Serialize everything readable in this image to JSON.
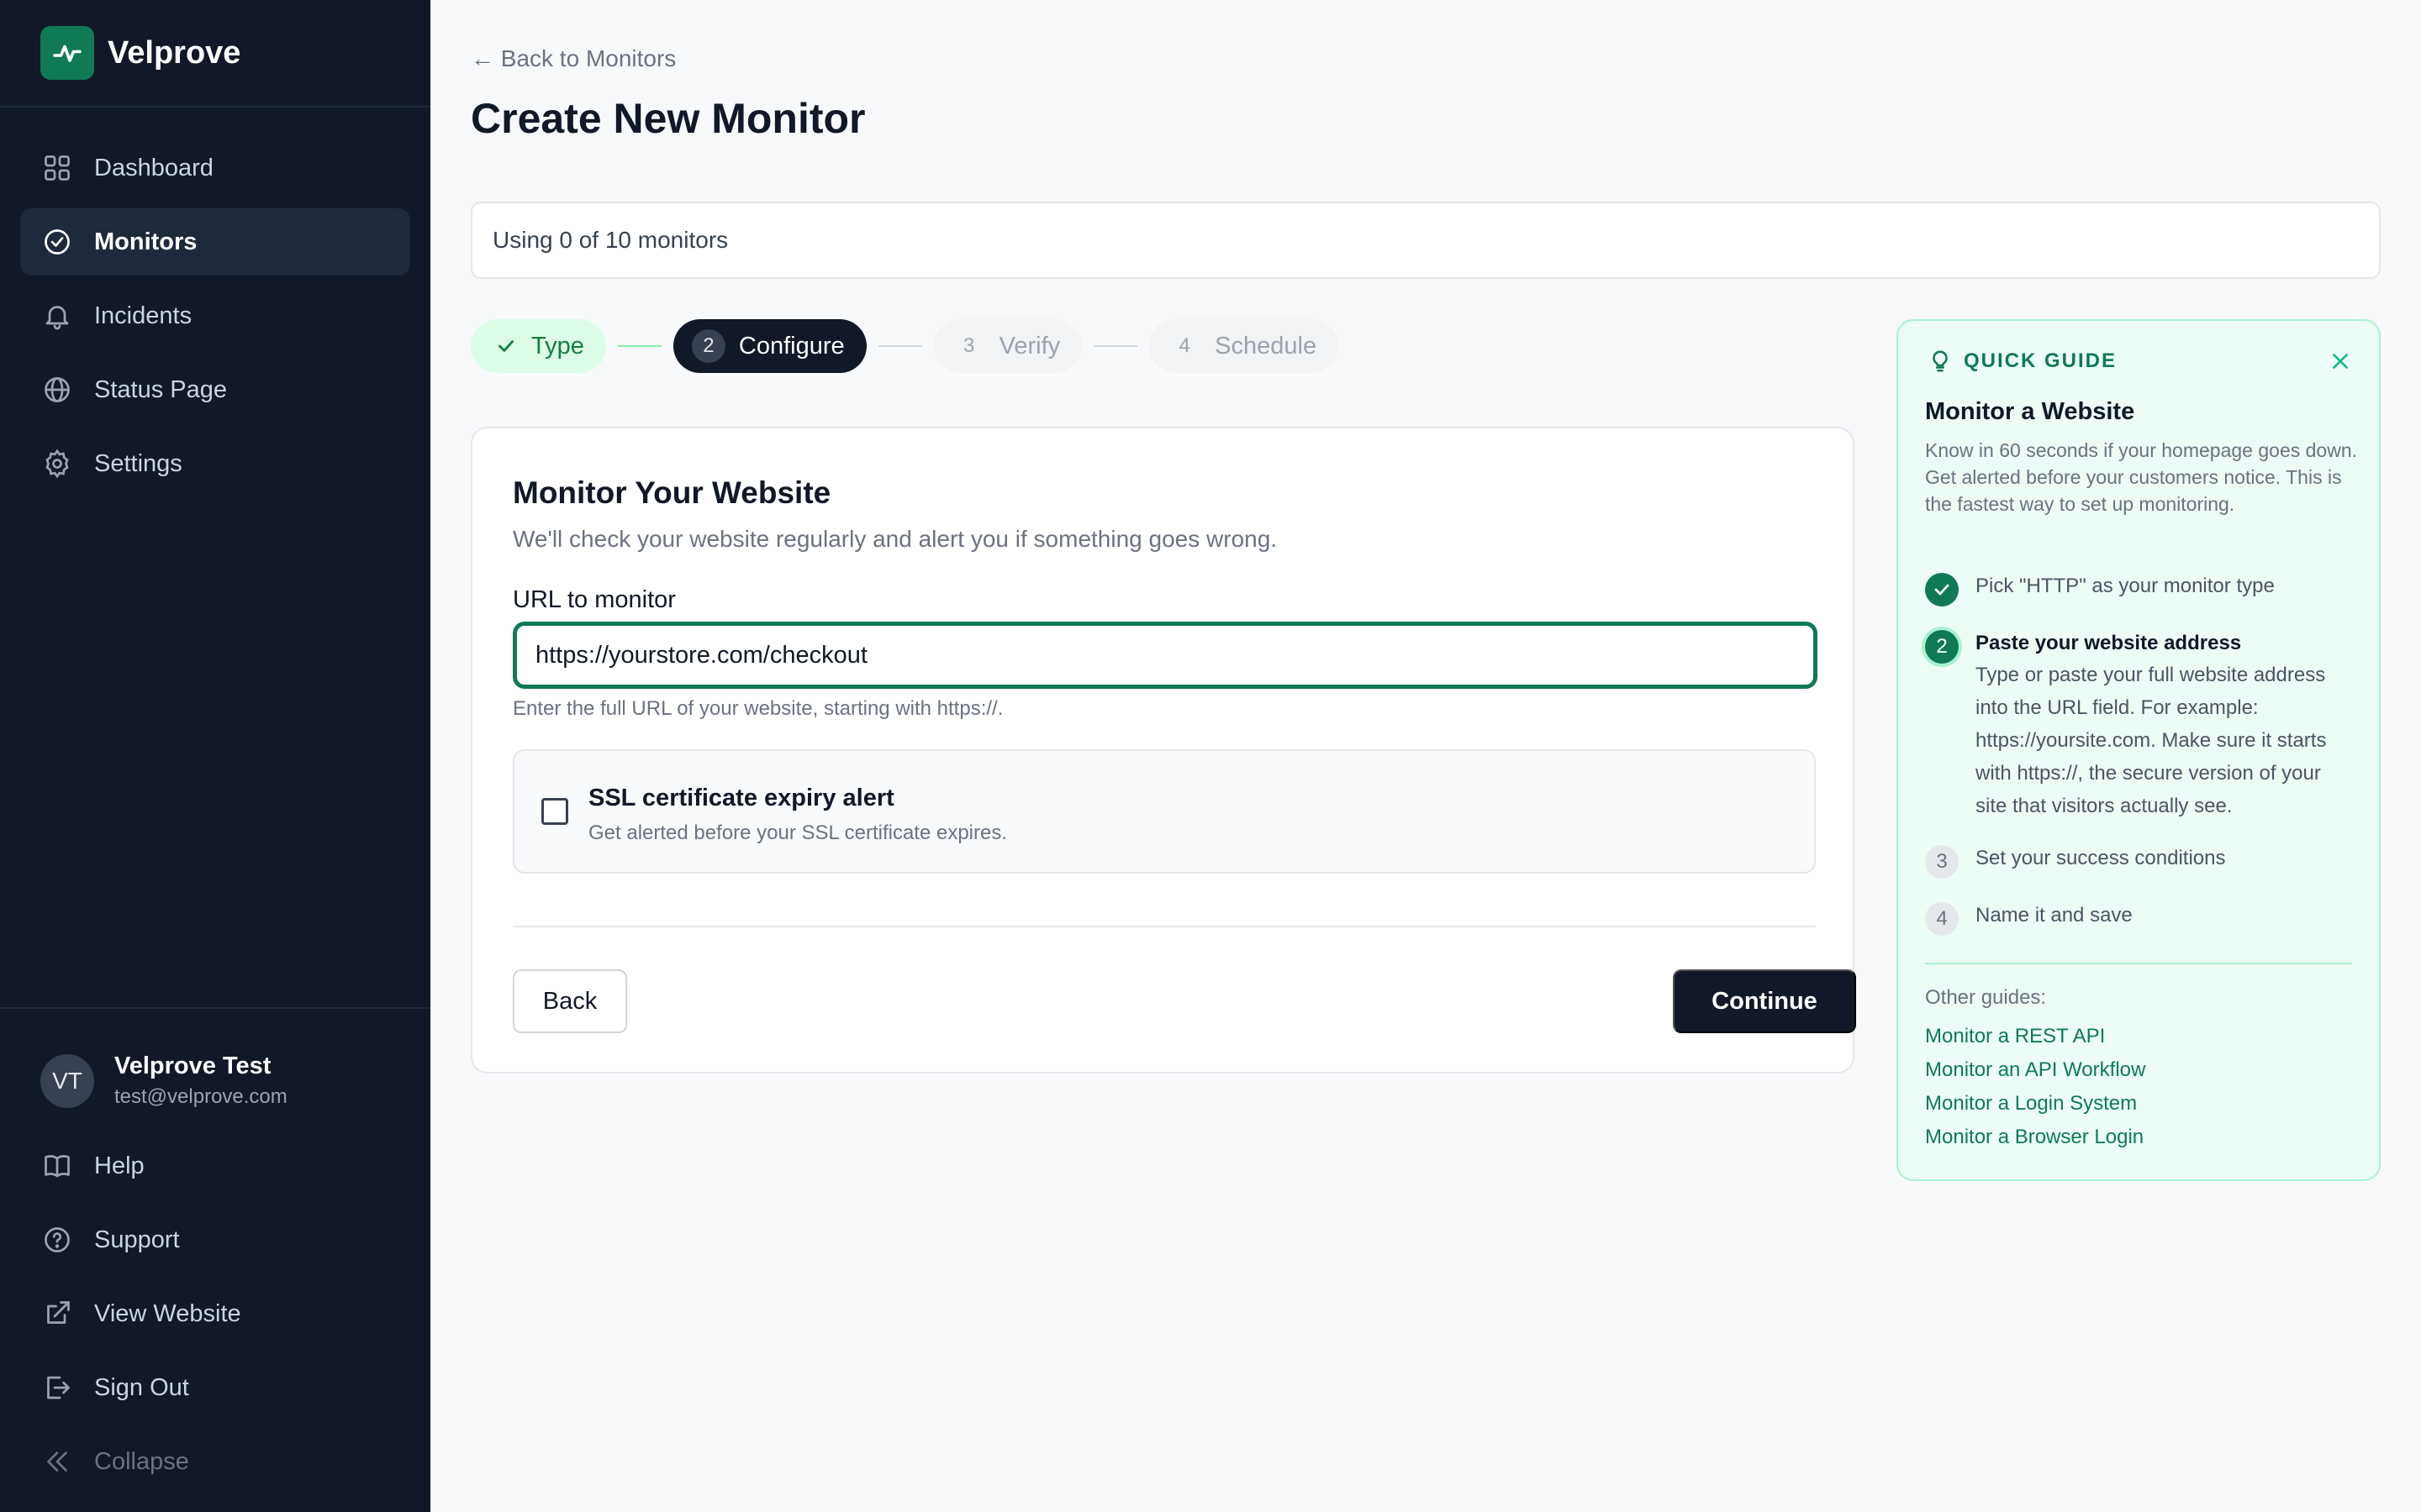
{
  "brand": {
    "name": "Velprove"
  },
  "sidebar": {
    "items": [
      {
        "label": "Dashboard",
        "icon": "grid-icon"
      },
      {
        "label": "Monitors",
        "icon": "check-circle-icon",
        "active": true
      },
      {
        "label": "Incidents",
        "icon": "bell-icon"
      },
      {
        "label": "Status Page",
        "icon": "globe-icon"
      },
      {
        "label": "Settings",
        "icon": "gear-icon"
      }
    ],
    "user": {
      "initials": "VT",
      "name": "Velprove Test",
      "email": "test@velprove.com"
    },
    "bottom_items": [
      {
        "label": "Help",
        "icon": "book-icon"
      },
      {
        "label": "Support",
        "icon": "question-circle-icon"
      },
      {
        "label": "View Website",
        "icon": "external-link-icon"
      },
      {
        "label": "Sign Out",
        "icon": "sign-out-icon"
      },
      {
        "label": "Collapse",
        "icon": "chevrons-left-icon"
      }
    ]
  },
  "header": {
    "back_link": "← Back to Monitors",
    "title": "Create New Monitor"
  },
  "usage": {
    "text": "Using 0 of 10 monitors"
  },
  "steps": [
    {
      "number": "",
      "label": "Type",
      "state": "done"
    },
    {
      "number": "2",
      "label": "Configure",
      "state": "current"
    },
    {
      "number": "3",
      "label": "Verify",
      "state": "future"
    },
    {
      "number": "4",
      "label": "Schedule",
      "state": "future"
    }
  ],
  "form": {
    "title": "Monitor Your Website",
    "subtitle": "We'll check your website regularly and alert you if something goes wrong.",
    "url_label": "URL to monitor",
    "url_value": "https://yourstore.com/checkout",
    "url_help": "Enter the full URL of your website, starting with https://.",
    "ssl_title": "SSL certificate expiry alert",
    "ssl_sub": "Get alerted before your SSL certificate expires.",
    "ssl_checked": false,
    "back_label": "Back",
    "continue_label": "Continue"
  },
  "guide": {
    "heading": "QUICK GUIDE",
    "title": "Monitor a Website",
    "description": "Know in 60 seconds if your homepage goes down. Get alerted before your customers notice. This is the fastest way to set up monitoring.",
    "steps": [
      {
        "number": "",
        "title": "Pick \"HTTP\" as your monitor type",
        "state": "done",
        "detail": ""
      },
      {
        "number": "2",
        "title": "Paste your website address",
        "state": "current",
        "detail": "Type or paste your full website address into the URL field. For example: https://yoursite.com. Make sure it starts with https://, the secure version of your site that visitors actually see."
      },
      {
        "number": "3",
        "title": "Set your success conditions",
        "state": "todo",
        "detail": ""
      },
      {
        "number": "4",
        "title": "Name it and save",
        "state": "todo",
        "detail": ""
      }
    ],
    "other_label": "Other guides:",
    "other_links": [
      "Monitor a REST API",
      "Monitor an API Workflow",
      "Monitor a Login System",
      "Monitor a Browser Login"
    ]
  },
  "colors": {
    "sidebar_bg": "#111827",
    "accent": "#0f7a55",
    "guide_bg": "#ecfdf5",
    "primary_button": "#111827"
  }
}
